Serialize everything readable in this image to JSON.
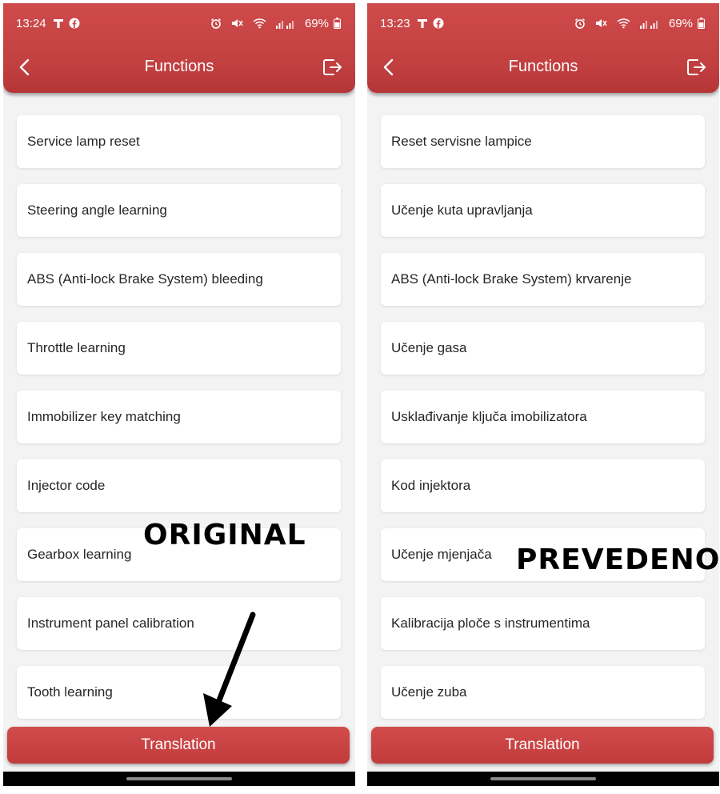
{
  "left_screen": {
    "status": {
      "time": "13:24",
      "battery": "69%"
    },
    "title": "Functions",
    "items": [
      "Service lamp reset",
      "Steering angle learning",
      "ABS (Anti-lock Brake System) bleeding",
      "Throttle learning",
      "Immobilizer key matching",
      "Injector code",
      "Gearbox learning",
      "Instrument panel calibration",
      "Tooth learning"
    ],
    "button": "Translation"
  },
  "right_screen": {
    "status": {
      "time": "13:23",
      "battery": "69%"
    },
    "title": "Functions",
    "items": [
      "Reset servisne lampice",
      "Učenje kuta upravljanja",
      "ABS (Anti-lock Brake System) krvarenje",
      "Učenje gasa",
      "Usklađivanje ključa imobilizatora",
      "Kod injektora",
      "Učenje mjenjača",
      "Kalibracija ploče s instrumentima",
      "Učenje zuba"
    ],
    "button": "Translation"
  },
  "annotations": {
    "left_label": "ORIGINAL",
    "right_label": "PREVEDENO"
  },
  "colors": {
    "accent": "#c94545",
    "background": "#f3f3f3",
    "item_bg": "#ffffff",
    "text": "#262626"
  },
  "icons": {
    "back": "chevron-left-icon",
    "exit": "logout-icon",
    "status": [
      "t-mobile-icon",
      "facebook-icon",
      "alarm-icon",
      "mute-icon",
      "wifi-icon",
      "signal-icon",
      "battery-icon"
    ]
  }
}
